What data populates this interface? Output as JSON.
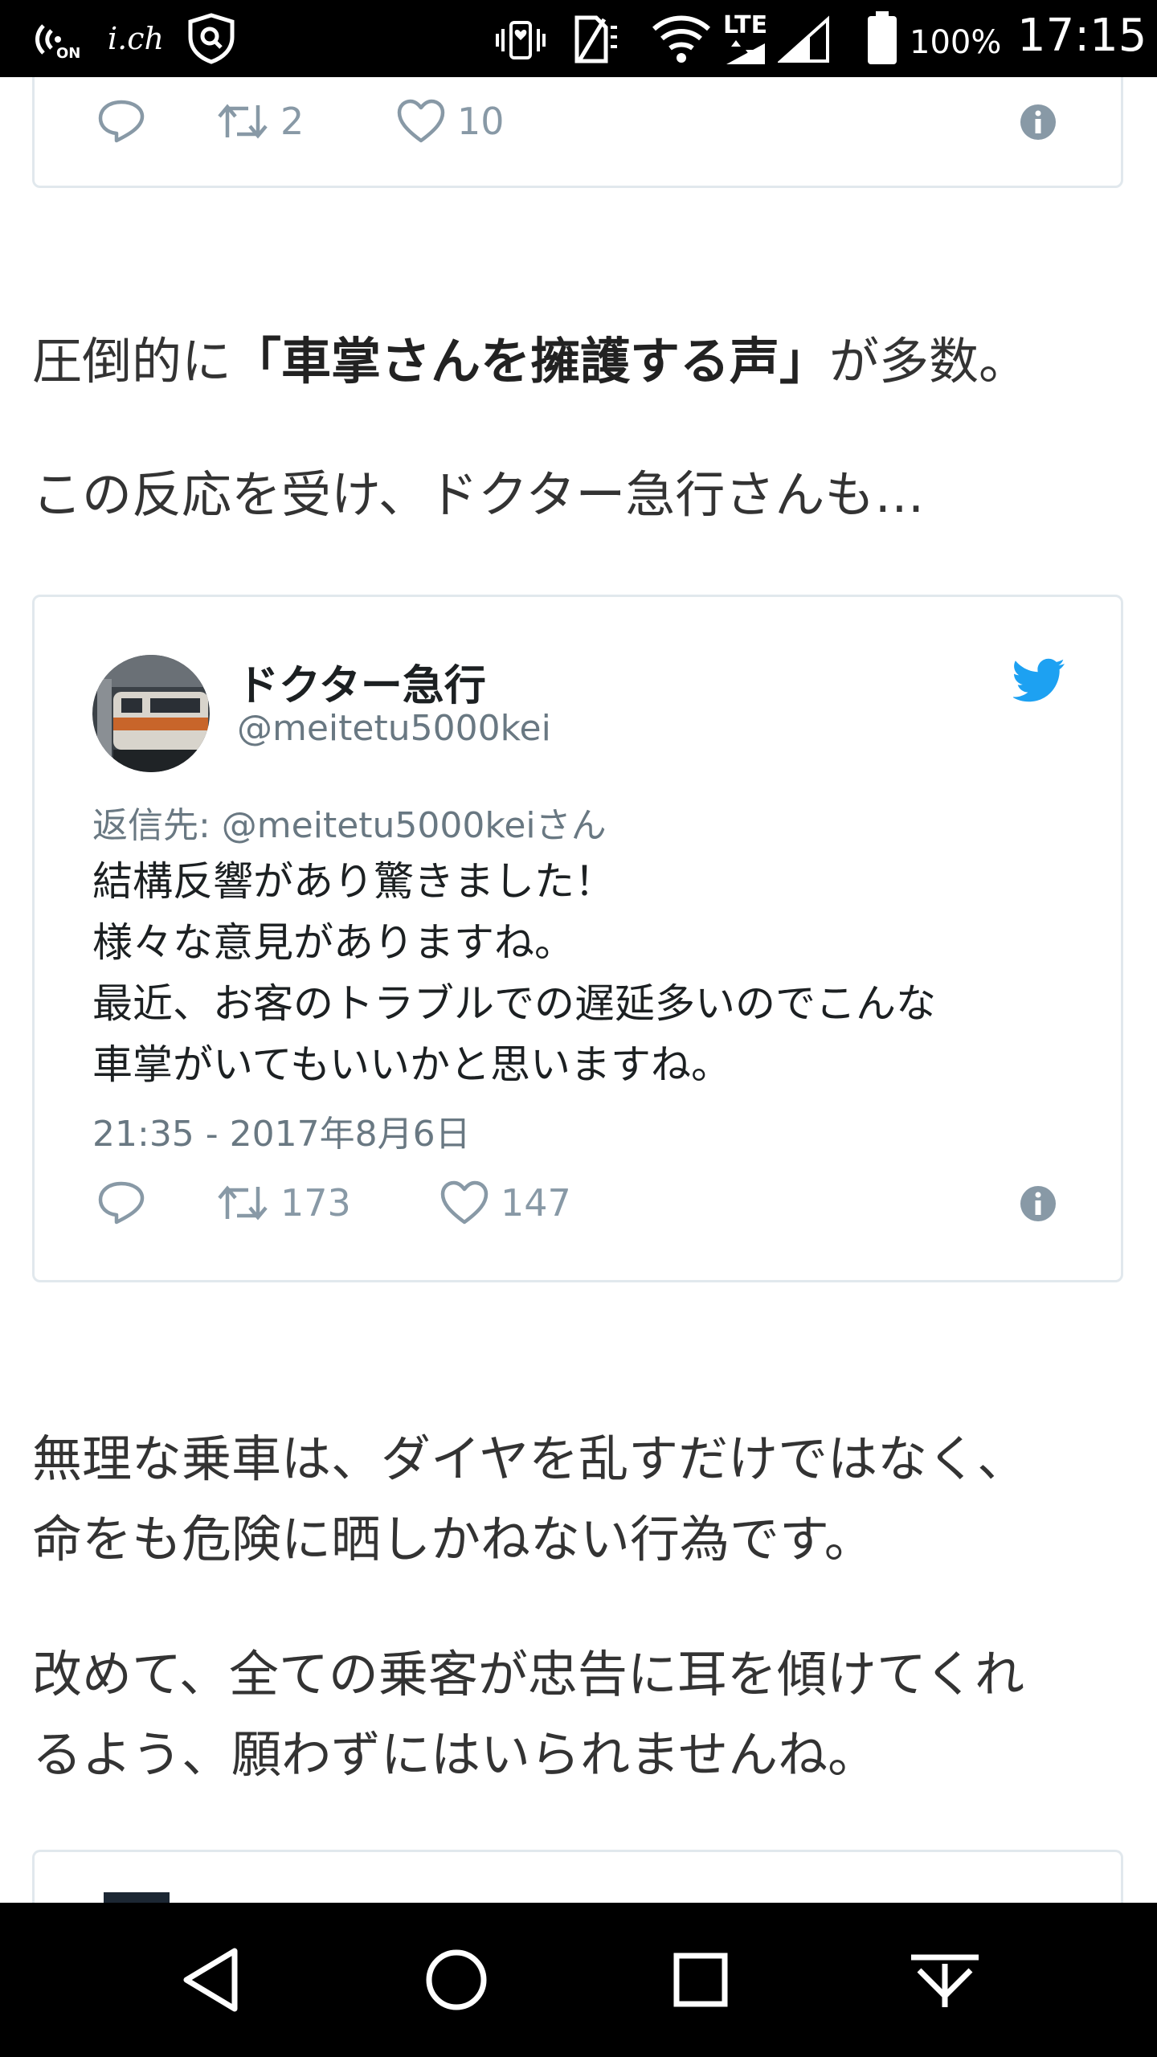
{
  "status_bar": {
    "left_icons": [
      "nfc-on-icon",
      "ich-app-icon",
      "shield-search-icon"
    ],
    "ich_label": "i.ch",
    "nfc_label": "ON",
    "right_icons": [
      "vibrate-icon",
      "no-sim-icon",
      "wifi-icon",
      "lte-signal-icon",
      "cell-signal-icon",
      "battery-icon"
    ],
    "network": "LTE",
    "battery": "100%",
    "time": "17:15"
  },
  "top_tweet": {
    "retweets": "2",
    "likes": "10"
  },
  "paragraphs": {
    "p1_prefix": "圧倒的に",
    "p1_bold": "「車掌さんを擁護する声」",
    "p1_suffix": "が多数。",
    "p2": "この反応を受け、ドクター急行さんも…",
    "p3_line1": "無理な乗車は、ダイヤを乱すだけではなく、",
    "p3_line2": "命をも危険に晒しかねない行為です。",
    "p4_line1": "改めて、全ての乗客が忠告に耳を傾けてくれ",
    "p4_line2": "るよう、願わずにはいられませんね。"
  },
  "embedded_tweet": {
    "display_name": "ドクター急行",
    "handle": "@meitetu5000kei",
    "reply_to": "返信先: @meitetu5000keiさん",
    "body_lines": [
      "結構反響があり驚きました！",
      "様々な意見がありますね。",
      "最近、お客のトラブルでの遅延多いのでこんな",
      "車掌がいてもいいかと思いますね。"
    ],
    "timestamp": "21:35 - 2017年8月6日",
    "retweets": "173",
    "likes": "147",
    "brand_color": "#1da1f2"
  },
  "nav_bar": {
    "buttons": [
      "back",
      "home",
      "recents",
      "notifications"
    ]
  }
}
